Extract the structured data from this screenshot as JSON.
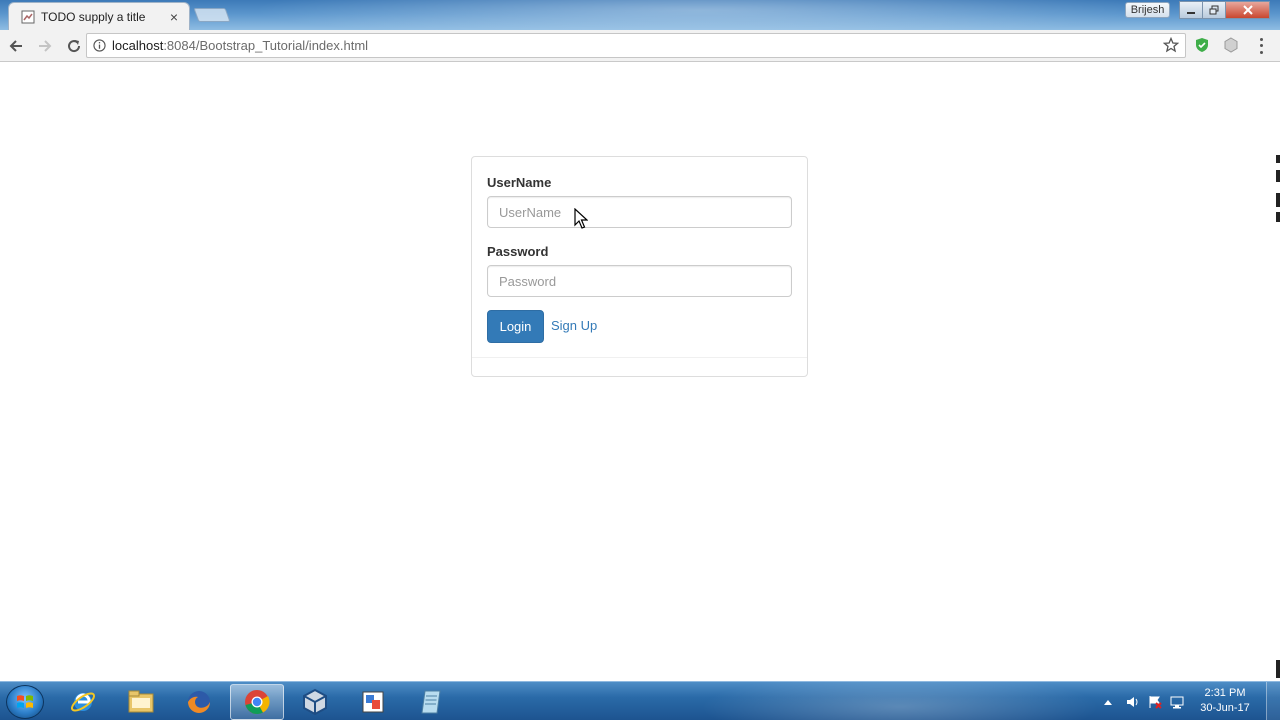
{
  "browser": {
    "tab_title": "TODO supply a title",
    "tab_close": "×",
    "profile_name": "Brijesh",
    "url_host": "localhost",
    "url_rest": ":8084/Bootstrap_Tutorial/index.html"
  },
  "form": {
    "username_label": "UserName",
    "username_placeholder": "UserName",
    "username_value": "",
    "password_label": "Password",
    "password_placeholder": "Password",
    "password_value": "",
    "login_label": "Login",
    "signup_label": "Sign Up",
    "accent_color": "#337ab7"
  },
  "taskbar": {
    "time": "2:31 PM",
    "date": "30-Jun-17",
    "apps": [
      "internet-explorer-icon",
      "file-explorer-icon",
      "firefox-icon",
      "chrome-icon",
      "virtualbox-icon",
      "photo-app-icon",
      "notepad-icon"
    ]
  }
}
